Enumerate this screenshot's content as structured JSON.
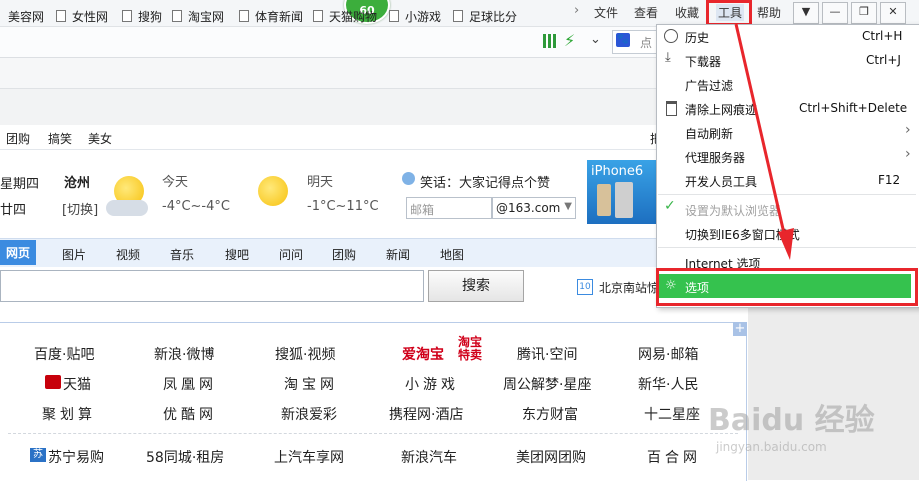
{
  "titlebar": {
    "badge": "60",
    "menus": [
      "文件",
      "查看",
      "收藏",
      "工具",
      "帮助"
    ],
    "window_buttons": [
      "shirt",
      "minimize",
      "restore",
      "close"
    ]
  },
  "addressbar": {
    "search_hint": "点"
  },
  "bookmarks": [
    "美容网",
    "女性网",
    "搜狗",
    "淘宝网",
    "体育新闻",
    "天猫购物",
    "小游戏",
    "足球比分"
  ],
  "categories": [
    "团购",
    "搞笑",
    "美女"
  ],
  "weather": {
    "day": "星期四",
    "lunar": "廿四",
    "city": "沧州",
    "switch": "[切换]",
    "today_label": "今天",
    "today_temp": "-4°C~-4°C",
    "tomorrow_label": "明天",
    "tomorrow_temp": "-1°C~11°C"
  },
  "joke": "笑话：大家记得点个赞",
  "mail": {
    "placeholder": "邮箱",
    "domain": "@163.com"
  },
  "ad": {
    "text": "iPhone6"
  },
  "search": {
    "tabs": [
      "网页",
      "图片",
      "视频",
      "音乐",
      "搜吧",
      "问问",
      "团购",
      "新闻",
      "地图"
    ],
    "button": "搜索"
  },
  "news_ticker": {
    "num": "10",
    "text": "北京南站惊"
  },
  "links": {
    "row1": [
      "百度·贴吧",
      "新浪·微博",
      "搜狐·视频",
      "爱淘宝",
      "腾讯·空间",
      "网易·邮箱"
    ],
    "row2": [
      "天猫",
      "凤凰网",
      "淘宝网",
      "小游戏",
      "周公解梦·星座",
      "新华·人民"
    ],
    "row3": [
      "聚划算",
      "优酷网",
      "新浪爱彩",
      "携程网·酒店",
      "东方财富",
      "十二星座"
    ],
    "row4": [
      "苏宁易购",
      "58同城·租房",
      "上汽车享网",
      "新浪汽车",
      "美团网团购",
      "百合网"
    ],
    "taobao_badge": "淘宝特卖"
  },
  "tools_menu": {
    "items": [
      {
        "label": "历史",
        "shortcut": "Ctrl+H"
      },
      {
        "label": "下载器",
        "shortcut": "Ctrl+J"
      },
      {
        "label": "广告过滤",
        "shortcut": ""
      },
      {
        "label": "清除上网痕迹",
        "shortcut": "Ctrl+Shift+Delete"
      },
      {
        "label": "自动刷新",
        "shortcut": ""
      },
      {
        "label": "代理服务器",
        "shortcut": ""
      },
      {
        "label": "开发人员工具",
        "shortcut": "F12"
      },
      {
        "label": "设置为默认浏览器",
        "shortcut": ""
      },
      {
        "label": "切换到IE6多窗口模式",
        "shortcut": ""
      },
      {
        "label": "Internet 选项",
        "shortcut": ""
      },
      {
        "label": "选项",
        "shortcut": ""
      }
    ]
  },
  "right_hint": "把",
  "watermark": {
    "main": "Baidu 经验",
    "sub": "jingyan.baidu.com"
  },
  "colors": {
    "highlight_green": "#35c24e",
    "annotation_red": "#e8262c",
    "badge_green": "#3cae3c"
  }
}
